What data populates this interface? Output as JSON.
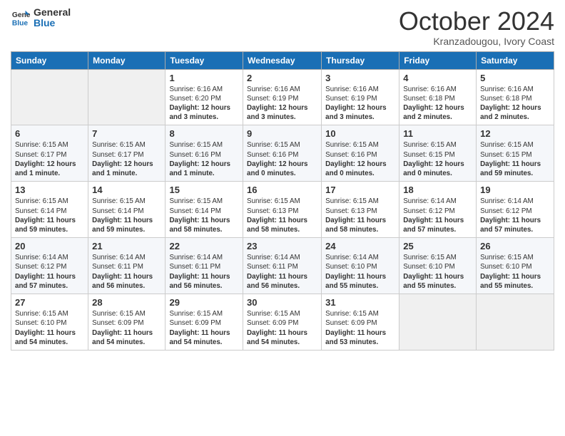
{
  "header": {
    "logo_line1": "General",
    "logo_line2": "Blue",
    "month": "October 2024",
    "location": "Kranzadougou, Ivory Coast"
  },
  "weekdays": [
    "Sunday",
    "Monday",
    "Tuesday",
    "Wednesday",
    "Thursday",
    "Friday",
    "Saturday"
  ],
  "weeks": [
    [
      {
        "day": "",
        "info": ""
      },
      {
        "day": "",
        "info": ""
      },
      {
        "day": "1",
        "info": "Sunrise: 6:16 AM\nSunset: 6:20 PM\nDaylight: 12 hours and 3 minutes."
      },
      {
        "day": "2",
        "info": "Sunrise: 6:16 AM\nSunset: 6:19 PM\nDaylight: 12 hours and 3 minutes."
      },
      {
        "day": "3",
        "info": "Sunrise: 6:16 AM\nSunset: 6:19 PM\nDaylight: 12 hours and 3 minutes."
      },
      {
        "day": "4",
        "info": "Sunrise: 6:16 AM\nSunset: 6:18 PM\nDaylight: 12 hours and 2 minutes."
      },
      {
        "day": "5",
        "info": "Sunrise: 6:16 AM\nSunset: 6:18 PM\nDaylight: 12 hours and 2 minutes."
      }
    ],
    [
      {
        "day": "6",
        "info": "Sunrise: 6:15 AM\nSunset: 6:17 PM\nDaylight: 12 hours and 1 minute."
      },
      {
        "day": "7",
        "info": "Sunrise: 6:15 AM\nSunset: 6:17 PM\nDaylight: 12 hours and 1 minute."
      },
      {
        "day": "8",
        "info": "Sunrise: 6:15 AM\nSunset: 6:16 PM\nDaylight: 12 hours and 1 minute."
      },
      {
        "day": "9",
        "info": "Sunrise: 6:15 AM\nSunset: 6:16 PM\nDaylight: 12 hours and 0 minutes."
      },
      {
        "day": "10",
        "info": "Sunrise: 6:15 AM\nSunset: 6:16 PM\nDaylight: 12 hours and 0 minutes."
      },
      {
        "day": "11",
        "info": "Sunrise: 6:15 AM\nSunset: 6:15 PM\nDaylight: 12 hours and 0 minutes."
      },
      {
        "day": "12",
        "info": "Sunrise: 6:15 AM\nSunset: 6:15 PM\nDaylight: 11 hours and 59 minutes."
      }
    ],
    [
      {
        "day": "13",
        "info": "Sunrise: 6:15 AM\nSunset: 6:14 PM\nDaylight: 11 hours and 59 minutes."
      },
      {
        "day": "14",
        "info": "Sunrise: 6:15 AM\nSunset: 6:14 PM\nDaylight: 11 hours and 59 minutes."
      },
      {
        "day": "15",
        "info": "Sunrise: 6:15 AM\nSunset: 6:14 PM\nDaylight: 11 hours and 58 minutes."
      },
      {
        "day": "16",
        "info": "Sunrise: 6:15 AM\nSunset: 6:13 PM\nDaylight: 11 hours and 58 minutes."
      },
      {
        "day": "17",
        "info": "Sunrise: 6:15 AM\nSunset: 6:13 PM\nDaylight: 11 hours and 58 minutes."
      },
      {
        "day": "18",
        "info": "Sunrise: 6:14 AM\nSunset: 6:12 PM\nDaylight: 11 hours and 57 minutes."
      },
      {
        "day": "19",
        "info": "Sunrise: 6:14 AM\nSunset: 6:12 PM\nDaylight: 11 hours and 57 minutes."
      }
    ],
    [
      {
        "day": "20",
        "info": "Sunrise: 6:14 AM\nSunset: 6:12 PM\nDaylight: 11 hours and 57 minutes."
      },
      {
        "day": "21",
        "info": "Sunrise: 6:14 AM\nSunset: 6:11 PM\nDaylight: 11 hours and 56 minutes."
      },
      {
        "day": "22",
        "info": "Sunrise: 6:14 AM\nSunset: 6:11 PM\nDaylight: 11 hours and 56 minutes."
      },
      {
        "day": "23",
        "info": "Sunrise: 6:14 AM\nSunset: 6:11 PM\nDaylight: 11 hours and 56 minutes."
      },
      {
        "day": "24",
        "info": "Sunrise: 6:14 AM\nSunset: 6:10 PM\nDaylight: 11 hours and 55 minutes."
      },
      {
        "day": "25",
        "info": "Sunrise: 6:15 AM\nSunset: 6:10 PM\nDaylight: 11 hours and 55 minutes."
      },
      {
        "day": "26",
        "info": "Sunrise: 6:15 AM\nSunset: 6:10 PM\nDaylight: 11 hours and 55 minutes."
      }
    ],
    [
      {
        "day": "27",
        "info": "Sunrise: 6:15 AM\nSunset: 6:10 PM\nDaylight: 11 hours and 54 minutes."
      },
      {
        "day": "28",
        "info": "Sunrise: 6:15 AM\nSunset: 6:09 PM\nDaylight: 11 hours and 54 minutes."
      },
      {
        "day": "29",
        "info": "Sunrise: 6:15 AM\nSunset: 6:09 PM\nDaylight: 11 hours and 54 minutes."
      },
      {
        "day": "30",
        "info": "Sunrise: 6:15 AM\nSunset: 6:09 PM\nDaylight: 11 hours and 54 minutes."
      },
      {
        "day": "31",
        "info": "Sunrise: 6:15 AM\nSunset: 6:09 PM\nDaylight: 11 hours and 53 minutes."
      },
      {
        "day": "",
        "info": ""
      },
      {
        "day": "",
        "info": ""
      }
    ]
  ]
}
